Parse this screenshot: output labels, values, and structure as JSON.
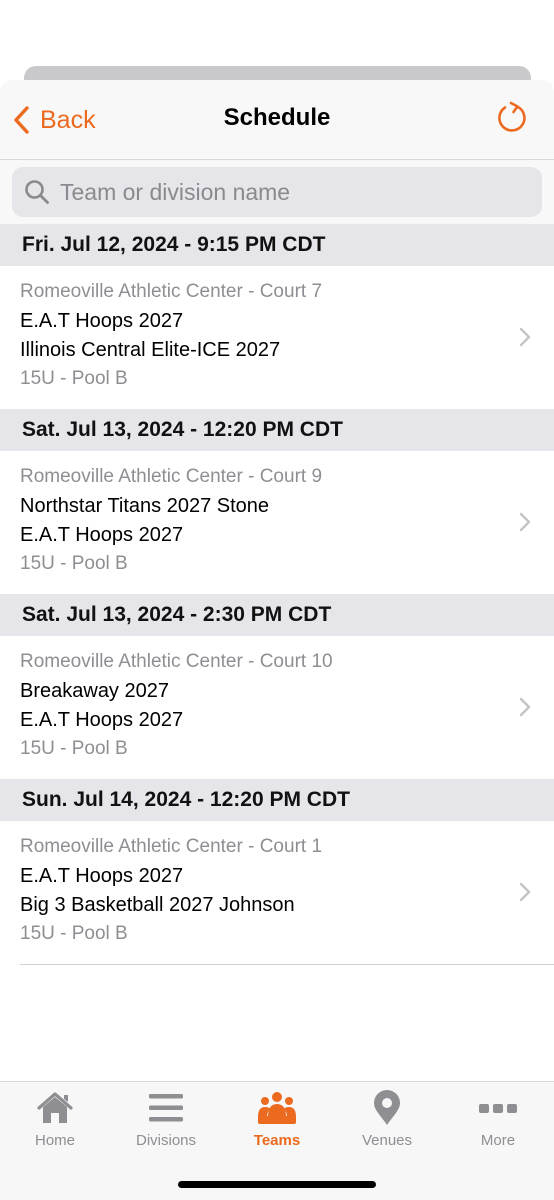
{
  "nav": {
    "back_label": "Back",
    "title": "Schedule"
  },
  "search": {
    "placeholder": "Team or division name",
    "value": ""
  },
  "sections": [
    {
      "header": "Fri. Jul 12, 2024 - 9:15 PM CDT",
      "venue": "Romeoville Athletic Center - Court 7",
      "team1": "E.A.T Hoops 2027",
      "team2": "Illinois Central Elite-ICE 2027",
      "division": "15U - Pool B"
    },
    {
      "header": "Sat. Jul 13, 2024 - 12:20 PM CDT",
      "venue": "Romeoville Athletic Center - Court 9",
      "team1": "Northstar Titans 2027 Stone",
      "team2": "E.A.T Hoops 2027",
      "division": "15U - Pool B"
    },
    {
      "header": "Sat. Jul 13, 2024 - 2:30 PM CDT",
      "venue": "Romeoville Athletic Center - Court 10",
      "team1": "Breakaway 2027",
      "team2": "E.A.T Hoops 2027",
      "division": "15U - Pool B"
    },
    {
      "header": "Sun. Jul 14, 2024 - 12:20 PM CDT",
      "venue": "Romeoville Athletic Center - Court 1",
      "team1": "E.A.T Hoops 2027",
      "team2": "Big 3 Basketball 2027 Johnson",
      "division": "15U - Pool B"
    }
  ],
  "tabs": [
    {
      "label": "Home",
      "icon": "home-icon",
      "active": false
    },
    {
      "label": "Divisions",
      "icon": "list-icon",
      "active": false
    },
    {
      "label": "Teams",
      "icon": "team-icon",
      "active": true
    },
    {
      "label": "Venues",
      "icon": "location-pin-icon",
      "active": false
    },
    {
      "label": "More",
      "icon": "more-dots-icon",
      "active": false
    }
  ],
  "colors": {
    "accent": "#ec6a1f",
    "inactive": "#8e8e93",
    "section_bg": "#e6e6ea"
  }
}
